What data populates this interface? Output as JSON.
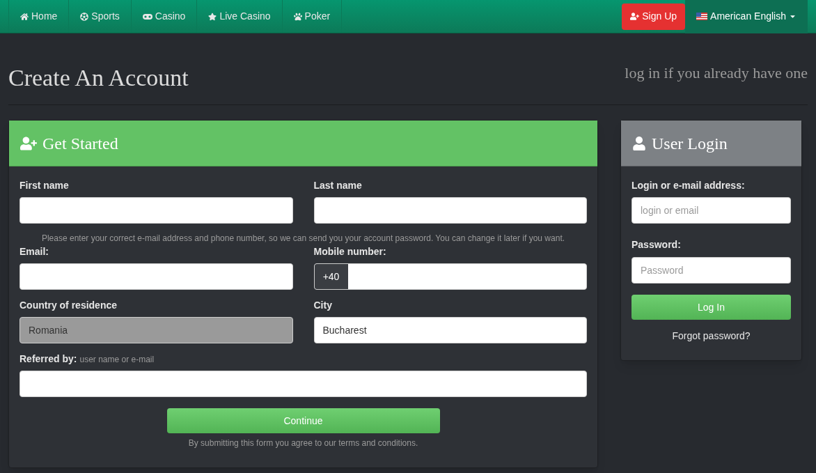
{
  "nav": {
    "items": [
      {
        "label": "Home"
      },
      {
        "label": "Sports"
      },
      {
        "label": "Casino"
      },
      {
        "label": "Live Casino"
      },
      {
        "label": "Poker"
      }
    ],
    "signup": "Sign Up",
    "language": "American English"
  },
  "heading": "Create An Account",
  "login_link": "log in if you already have one",
  "register": {
    "title": "Get Started",
    "first_name": {
      "label": "First name"
    },
    "last_name": {
      "label": "Last name"
    },
    "note": "Please enter your correct e-mail address and phone number, so we can send you your account password. You can change it later if you want.",
    "email": {
      "label": "Email:"
    },
    "mobile": {
      "label": "Mobile number:",
      "prefix": "+40"
    },
    "country": {
      "label": "Country of residence",
      "value": "Romania",
      "disabled": true
    },
    "city": {
      "label": "City",
      "value": "Bucharest",
      "disabled": false
    },
    "referred": {
      "label": "Referred by:",
      "hint": "user name or e-mail"
    },
    "button": "Continue",
    "terms": "By submitting this form you agree to our terms and conditions."
  },
  "login": {
    "title": "User Login",
    "login_label": "Login or e-mail address:",
    "login_placeholder": "login or email",
    "password_label": "Password:",
    "password_placeholder": "Password",
    "button": "Log In",
    "forgot": "Forgot password?"
  }
}
